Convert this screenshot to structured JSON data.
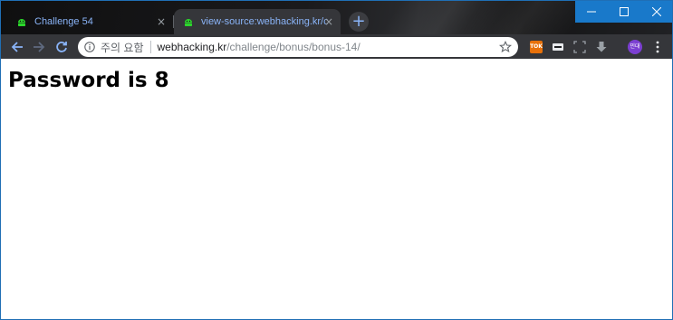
{
  "browser": {
    "tabs": [
      {
        "title": "Challenge 54",
        "active": false
      },
      {
        "title": "view-source:webhacking.kr/chall",
        "active": true
      }
    ],
    "new_tab_symbol": "+",
    "close_symbol": "×"
  },
  "toolbar": {
    "security_label": "주의 요함",
    "url_host": "webhacking.kr",
    "url_path": "/challenge/bonus/bonus-14/",
    "extension_badge": "TOK",
    "profile_initials": "민대"
  },
  "page": {
    "heading": "Password is 8"
  },
  "colors": {
    "accent": "#8ab4f8",
    "favicon": "#2bd72b",
    "window_controls": "#1979ca",
    "toolbar": "#35363a"
  },
  "icons": [
    "android-favicon-icon",
    "back-arrow-icon",
    "forward-arrow-icon",
    "reload-icon",
    "info-icon",
    "star-icon",
    "minimize-icon",
    "maximize-icon",
    "close-icon",
    "menu-dots-icon"
  ]
}
